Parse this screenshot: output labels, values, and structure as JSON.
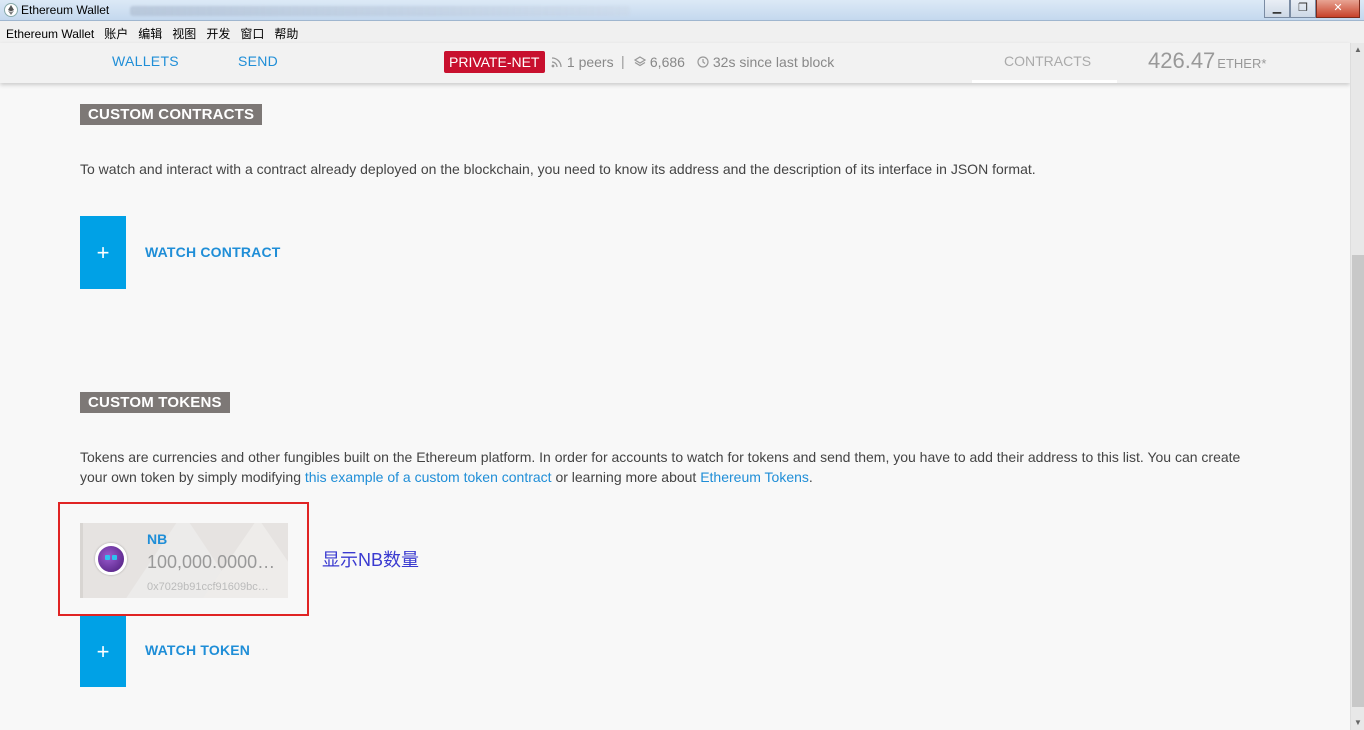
{
  "window": {
    "title": "Ethereum Wallet",
    "minimize": "▁",
    "maximize": "❐",
    "close": "✕"
  },
  "menu": [
    "Ethereum Wallet",
    "账户",
    "编辑",
    "视图",
    "开发",
    "窗口",
    "帮助"
  ],
  "header": {
    "nav_wallets": "WALLETS",
    "nav_send": "SEND",
    "network": "PRIVATE-NET",
    "peers": "1 peers",
    "separator": "|",
    "blocks": "6,686",
    "since_last_block": "32s since last block",
    "tab_contracts": "CONTRACTS",
    "balance": "426.47",
    "balance_unit": "ETHER*"
  },
  "contracts": {
    "title": "CUSTOM CONTRACTS",
    "description": "To watch and interact with a contract already deployed on the blockchain, you need to know its address and the description of its interface in JSON format.",
    "plus": "+",
    "watch_label": "WATCH CONTRACT"
  },
  "tokens": {
    "title": "CUSTOM TOKENS",
    "desc_part1": "Tokens are currencies and other fungibles built on the Ethereum platform. In order for accounts to watch for tokens and send them, you have to add their address to this list. You can create your own token by simply modifying ",
    "link1": "this example of a custom token contract",
    "desc_part2": " or learning more about ",
    "link2": "Ethereum Tokens",
    "desc_part3": ".",
    "items": [
      {
        "name": "NB",
        "amount": "100,000.0000…",
        "address": "0x7029b91ccf91609bc…"
      }
    ],
    "plus": "+",
    "watch_label": "WATCH TOKEN"
  },
  "annotation": "显示NB数量"
}
